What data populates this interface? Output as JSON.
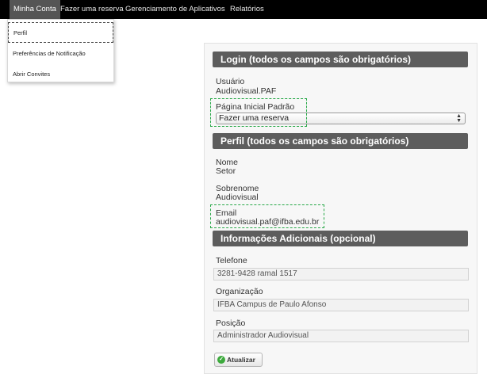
{
  "topnav": {
    "items": [
      {
        "label": "Minha Conta"
      },
      {
        "label": "Fazer uma reserva"
      },
      {
        "label": "Gerenciamento de Aplicativos"
      },
      {
        "label": "Relatórios"
      }
    ]
  },
  "dropdown": {
    "items": [
      {
        "label": "Perfil"
      },
      {
        "label": "Preferências de Notificação"
      },
      {
        "label": "Abrir Convites"
      }
    ]
  },
  "login": {
    "header": "Login (todos os campos são obrigatórios)",
    "usuario_label": "Usuário",
    "usuario_value": "Audiovisual.PAF",
    "pagina_label": "Página Inicial Padrão",
    "pagina_selected": "Fazer uma reserva"
  },
  "perfil": {
    "header": "Perfil (todos os campos são obrigatórios)",
    "nome_label": "Nome",
    "nome_value": "Setor",
    "sobrenome_label": "Sobrenome",
    "sobrenome_value": "Audiovisual",
    "email_label": "Email",
    "email_value": "audiovisual.paf@ifba.edu.br"
  },
  "adicionais": {
    "header": "Informações Adicionais (opcional)",
    "telefone_label": "Telefone",
    "telefone_value": "3281-9428 ramal 1517",
    "organizacao_label": "Organização",
    "organizacao_value": "IFBA Campus de Paulo Afonso",
    "posicao_label": "Posição",
    "posicao_value": "Administrador Audiovisual"
  },
  "actions": {
    "update_label": "Atualizar",
    "update_icon": "check-circle-icon"
  },
  "colors": {
    "nav_background": "#000000",
    "section_header": "#5d5d5d",
    "focus_outline": "#27a847",
    "button_icon": "#3daa3d"
  }
}
